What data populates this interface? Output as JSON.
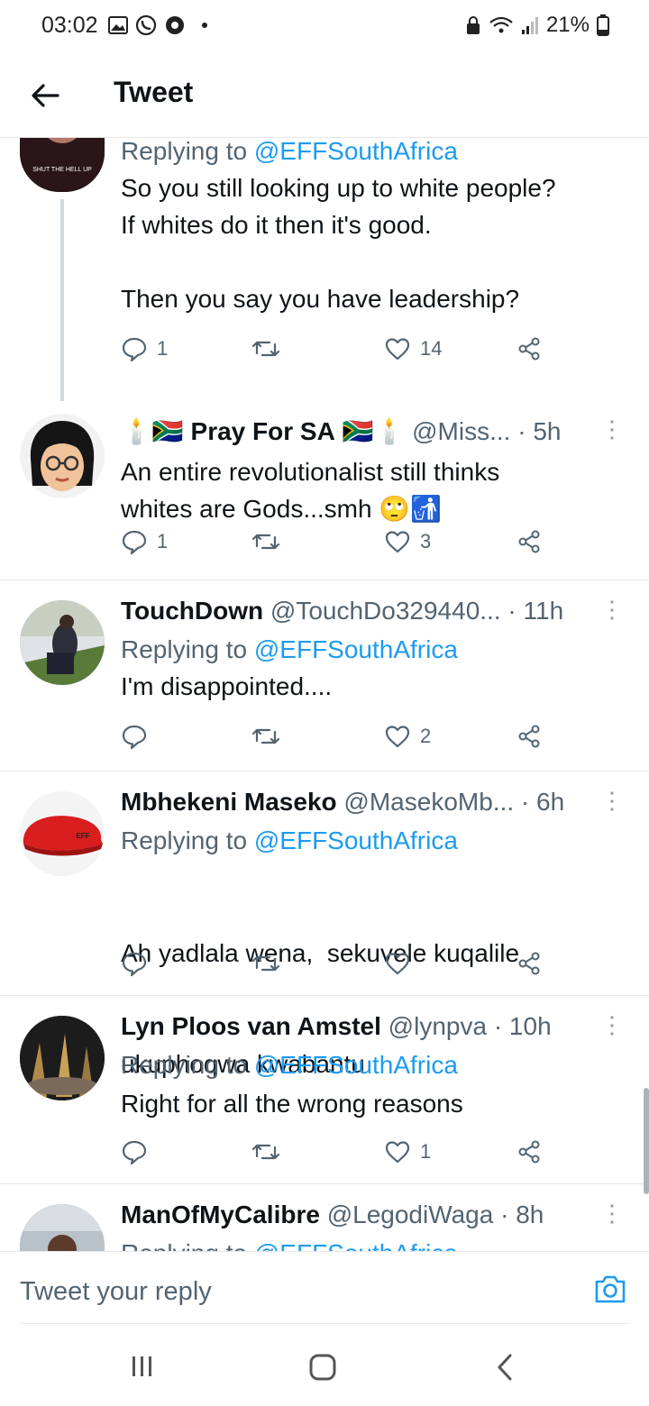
{
  "status_bar": {
    "time": "03:02",
    "battery": "21%",
    "icons": [
      "gallery-icon",
      "whatsapp-icon",
      "chrome-icon",
      "dot-icon",
      "lock-icon",
      "wifi-icon",
      "signal-icon",
      "battery-icon"
    ]
  },
  "header": {
    "title": "Tweet",
    "back_icon": "arrow-left-icon"
  },
  "tweets": [
    {
      "replying_label": "Replying to",
      "replying_to": "@EFFSouthAfrica",
      "lines": [
        "So you still looking up to white people?",
        "If whites do it then it's good.",
        "",
        "Then you say you have leadership?"
      ],
      "replies": "1",
      "likes": "14"
    },
    {
      "name": "Pray For SA",
      "handle": "@Miss...",
      "time": "· 5h",
      "lines": [
        "An entire revolutionalist still thinks",
        "whites are Gods...smh"
      ],
      "emoji": "🙄🚮",
      "replies": "1",
      "likes": "3"
    },
    {
      "name": "TouchDown",
      "handle": "@TouchDo329440...",
      "time": "· 11h",
      "replying_label": "Replying to",
      "replying_to": "@EFFSouthAfrica",
      "lines": [
        "I'm disappointed...."
      ],
      "likes": "2"
    },
    {
      "name": "Mbhekeni Maseko",
      "handle": "@MasekoMb...",
      "time": "· 6h",
      "replying_label": "Replying to",
      "replying_to": "@EFFSouthAfrica",
      "lines": [
        "Ah yadlala wena,  sekuvele kuqalile",
        "ukuphoqwa kwabantu"
      ],
      "avatar_text": "EFF"
    },
    {
      "name": "Lyn Ploos van Amstel",
      "handle": "@lynpva",
      "time": "· 10h",
      "replying_label": "Replying to",
      "replying_to": "@EFFSouthAfrica",
      "lines": [
        "Right for all the wrong reasons"
      ],
      "likes": "1"
    },
    {
      "name": "ManOfMyCalibre",
      "handle": "@LegodiWaga",
      "time": "· 8h",
      "replying_label": "Replying to",
      "replying_to": "@EFFSouthAfrica"
    }
  ],
  "composer": {
    "placeholder": "Tweet your reply",
    "camera_icon": "camera-icon"
  },
  "nav_bar": {
    "icons": [
      "recents-icon",
      "home-icon",
      "back-icon"
    ]
  },
  "colors": {
    "link": "#1d9bf0",
    "secondary_text": "#536471",
    "divider": "#e6e6e6"
  }
}
